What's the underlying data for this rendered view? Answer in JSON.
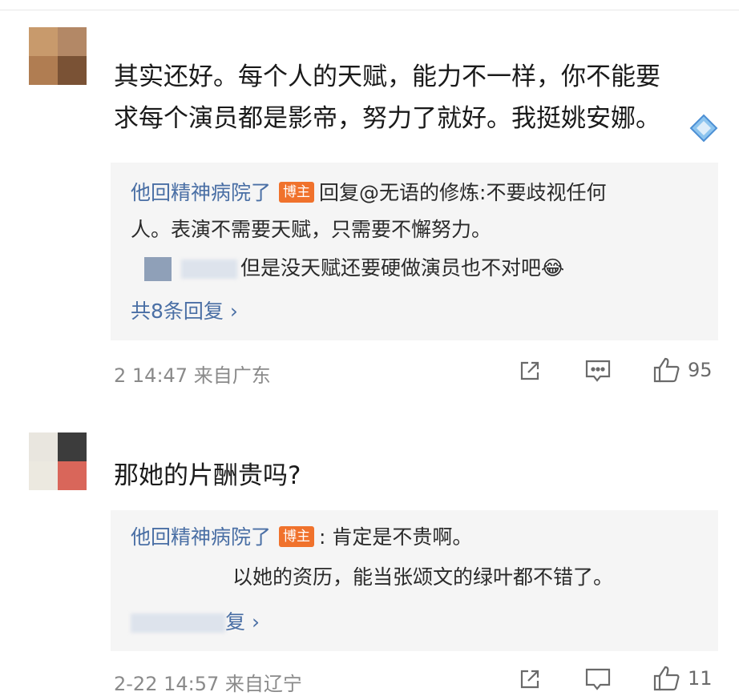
{
  "comments": [
    {
      "text_line1": "其实还好。每个人的天赋，能力不一样，你不能要",
      "text_line2": "求每个演员都是影帝，努力了就好。我挺姚安娜。",
      "replies": [
        {
          "author": "他回精神病院了",
          "badge": "博主",
          "text_line1": "回复@无语的修炼:不要歧视任何",
          "text_line2": "人。表演不需要天赋，只需要不懈努力。"
        },
        {
          "text": "但是没天赋还要硬做演员也不对吧😂"
        }
      ],
      "more_label": "共8条回复 ›",
      "time": "2 14:47",
      "source": "来自广东",
      "like_count": "95"
    },
    {
      "text": "那她的片酬贵吗?",
      "replies": [
        {
          "author": "他回精神病院了",
          "badge": "博主",
          "text": ": 肯定是不贵啊。"
        },
        {
          "text": "以她的资历，能当张颂文的绿叶都不错了。"
        }
      ],
      "more_label": "复 ›",
      "time": "2-22 14:57",
      "source": "来自辽宁",
      "like_count": "11"
    }
  ],
  "colors": {
    "author_link": "#4a6fa5",
    "op_badge": "#f0722c",
    "reply_bg": "#f5f5f5",
    "meta_text": "#8a8a8a"
  },
  "icons": [
    "share-icon",
    "comment-icon",
    "like-icon"
  ]
}
